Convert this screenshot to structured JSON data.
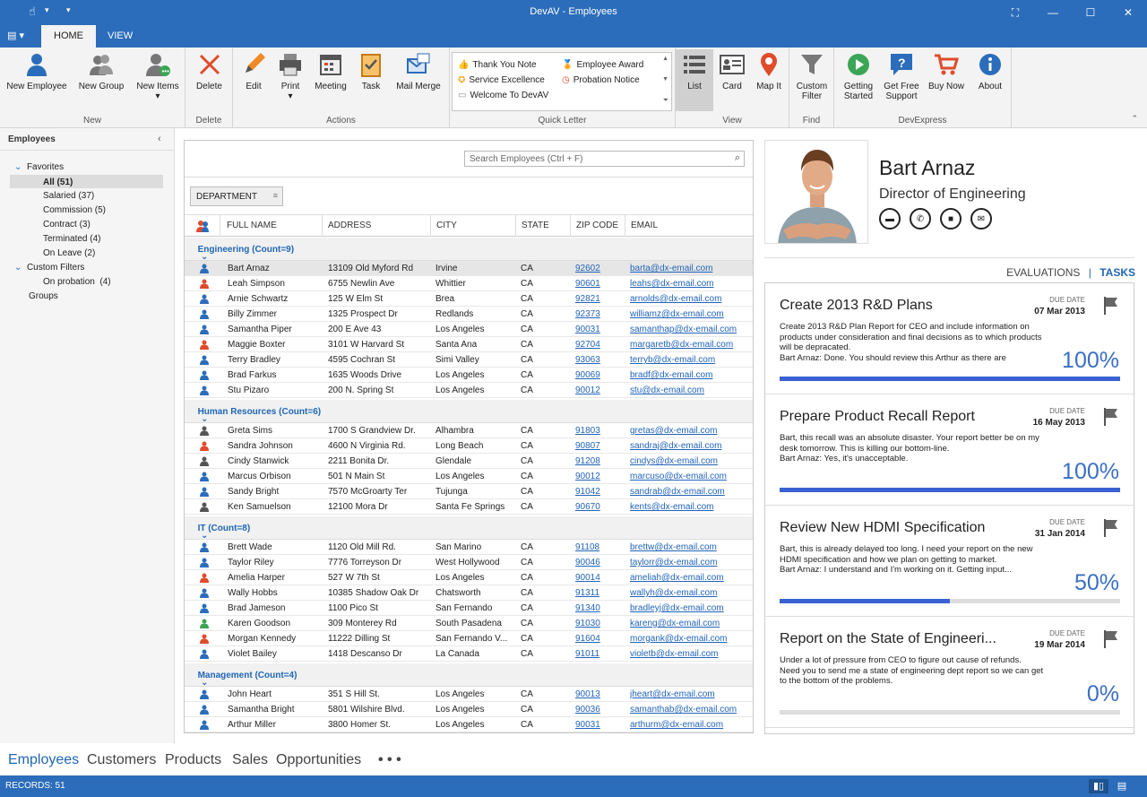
{
  "window": {
    "title": "DevAV - Employees"
  },
  "tabs": [
    {
      "label": "HOME"
    },
    {
      "label": "VIEW"
    }
  ],
  "ribbon": {
    "new_employee": "New Employee",
    "new_group": "New Group",
    "new_items": "New Items",
    "new_group_label": "New",
    "delete": "Delete",
    "delete_group_label": "Delete",
    "edit": "Edit",
    "print": "Print",
    "meeting": "Meeting",
    "task": "Task",
    "mail_merge": "Mail Merge",
    "actions_group_label": "Actions",
    "quick_letter": [
      "Thank You Note",
      "Employee Award",
      "Service Excellence",
      "Probation Notice",
      "Welcome To DevAV"
    ],
    "quick_letter_label": "Quick Letter",
    "list": "List",
    "card": "Card",
    "map_it": "Map It",
    "view_group_label": "View",
    "custom_filter": "Custom Filter",
    "find_group_label": "Find",
    "getting_started": "Getting Started",
    "get_free_support": "Get Free Support",
    "buy_now": "Buy Now",
    "about": "About",
    "devexpress_group_label": "DevExpress",
    "colors": {
      "blue": "#2b6dbb",
      "red": "#e04b2a",
      "green": "#3aa655",
      "orange": "#f08a24"
    }
  },
  "left_panel": {
    "title": "Employees",
    "favorites": "Favorites",
    "items": [
      "All (51)",
      "Salaried (37)",
      "Commission (5)",
      "Contract (3)",
      "Terminated (4)",
      "On Leave (2)"
    ],
    "custom_filters": "Custom Filters",
    "custom_items": [
      "On probation  (4)"
    ],
    "groups": "Groups"
  },
  "grid": {
    "search_placeholder": "Search Employees (Ctrl + F)",
    "group_by": "DEPARTMENT",
    "columns": [
      "FULL NAME",
      "ADDRESS",
      "CITY",
      "STATE",
      "ZIP CODE",
      "EMAIL"
    ],
    "groups": [
      {
        "label": "Engineering (Count=9)",
        "rows": [
          [
            "Bart Arnaz",
            "13109 Old Myford Rd",
            "Irvine",
            "CA",
            "92602",
            "barta@dx-email.com",
            "b"
          ],
          [
            "Leah Simpson",
            "6755 Newlin Ave",
            "Whittier",
            "CA",
            "90601",
            "leahs@dx-email.com",
            "r"
          ],
          [
            "Arnie Schwartz",
            "125 W Elm St",
            "Brea",
            "CA",
            "92821",
            "arnolds@dx-email.com",
            "b"
          ],
          [
            "Billy Zimmer",
            "1325 Prospect Dr",
            "Redlands",
            "CA",
            "92373",
            "williamz@dx-email.com",
            "b"
          ],
          [
            "Samantha Piper",
            "200 E Ave 43",
            "Los Angeles",
            "CA",
            "90031",
            "samanthap@dx-email.com",
            "b"
          ],
          [
            "Maggie Boxter",
            "3101 W Harvard St",
            "Santa Ana",
            "CA",
            "92704",
            "margaretb@dx-email.com",
            "r"
          ],
          [
            "Terry Bradley",
            "4595 Cochran St",
            "Simi Valley",
            "CA",
            "93063",
            "terryb@dx-email.com",
            "b"
          ],
          [
            "Brad Farkus",
            "1635 Woods Drive",
            "Los Angeles",
            "CA",
            "90069",
            "bradf@dx-email.com",
            "b"
          ],
          [
            "Stu Pizaro",
            "200 N. Spring St",
            "Los Angeles",
            "CA",
            "90012",
            "stu@dx-email.com",
            "b"
          ]
        ]
      },
      {
        "label": "Human Resources (Count=6)",
        "rows": [
          [
            "Greta Sims",
            "1700 S Grandview Dr.",
            "Alhambra",
            "CA",
            "91803",
            "gretas@dx-email.com",
            "k"
          ],
          [
            "Sandra Johnson",
            "4600 N Virginia Rd.",
            "Long Beach",
            "CA",
            "90807",
            "sandraj@dx-email.com",
            "r"
          ],
          [
            "Cindy Stanwick",
            "2211 Bonita Dr.",
            "Glendale",
            "CA",
            "91208",
            "cindys@dx-email.com",
            "k"
          ],
          [
            "Marcus Orbison",
            "501 N Main St",
            "Los Angeles",
            "CA",
            "90012",
            "marcuso@dx-email.com",
            "b"
          ],
          [
            "Sandy Bright",
            "7570 McGroarty Ter",
            "Tujunga",
            "CA",
            "91042",
            "sandrab@dx-email.com",
            "b"
          ],
          [
            "Ken Samuelson",
            "12100 Mora Dr",
            "Santa Fe Springs",
            "CA",
            "90670",
            "kents@dx-email.com",
            "k"
          ]
        ]
      },
      {
        "label": "IT (Count=8)",
        "rows": [
          [
            "Brett Wade",
            "1120 Old Mill Rd.",
            "San Marino",
            "CA",
            "91108",
            "brettw@dx-email.com",
            "b"
          ],
          [
            "Taylor Riley",
            "7776 Torreyson Dr",
            "West Hollywood",
            "CA",
            "90046",
            "taylorr@dx-email.com",
            "b"
          ],
          [
            "Amelia Harper",
            "527 W 7th St",
            "Los Angeles",
            "CA",
            "90014",
            "ameliah@dx-email.com",
            "r"
          ],
          [
            "Wally Hobbs",
            "10385 Shadow Oak Dr",
            "Chatsworth",
            "CA",
            "91311",
            "wallyh@dx-email.com",
            "b"
          ],
          [
            "Brad Jameson",
            "1100 Pico St",
            "San Fernando",
            "CA",
            "91340",
            "bradleyj@dx-email.com",
            "b"
          ],
          [
            "Karen Goodson",
            "309 Monterey Rd",
            "South Pasadena",
            "CA",
            "91030",
            "kareng@dx-email.com",
            "g"
          ],
          [
            "Morgan Kennedy",
            "11222 Dilling St",
            "San Fernando V...",
            "CA",
            "91604",
            "morgank@dx-email.com",
            "r"
          ],
          [
            "Violet Bailey",
            "1418 Descanso Dr",
            "La Canada",
            "CA",
            "91011",
            "violetb@dx-email.com",
            "b"
          ]
        ]
      },
      {
        "label": "Management (Count=4)",
        "rows": [
          [
            "John Heart",
            "351 S Hill St.",
            "Los Angeles",
            "CA",
            "90013",
            "jheart@dx-email.com",
            "b"
          ],
          [
            "Samantha Bright",
            "5801 Wilshire Blvd.",
            "Los Angeles",
            "CA",
            "90036",
            "samanthab@dx-email.com",
            "b"
          ],
          [
            "Arthur Miller",
            "3800 Homer St.",
            "Los Angeles",
            "CA",
            "90031",
            "arthurm@dx-email.com",
            "b"
          ]
        ]
      }
    ]
  },
  "detail": {
    "name": "Bart Arnaz",
    "title": "Director of Engineering",
    "tabs": {
      "evaluations": "EVALUATIONS",
      "sep": "|",
      "tasks": "TASKS"
    },
    "due_label": "DUE DATE",
    "tasks": [
      {
        "title": "Create 2013 R&D Plans",
        "due": "07 Mar 2013",
        "desc": "Create 2013 R&D Plan Report for CEO and include information on products under consideration and final decisions as to which products will be depracated.\nBart Arnaz: Done. You should review this Arthur as there are",
        "pct": "100%",
        "progress": 100
      },
      {
        "title": "Prepare Product Recall Report",
        "due": "16 May 2013",
        "desc": "Bart, this recall was an absolute disaster. Your report better be on my desk tomorrow. This is killing our bottom-line.\nBart Arnaz: Yes, it's unacceptable.",
        "pct": "100%",
        "progress": 100
      },
      {
        "title": "Review New HDMI Specification",
        "due": "31 Jan 2014",
        "desc": "Bart, this is already delayed too long. I need your report on the new HDMI specification and how we plan on getting to market.\nBart Arnaz: I understand and I'm working on it. Getting input...",
        "pct": "50%",
        "progress": 50
      },
      {
        "title": "Report on the State of Engineeri...",
        "due": "19 Mar 2014",
        "desc": "Under a lot of pressure from CEO to figure out cause of refunds. Need you to send me a state of engineering dept report so we can get to the bottom of the problems.",
        "pct": "0%",
        "progress": 0
      }
    ]
  },
  "nav": [
    "Employees",
    "Customers",
    "Products",
    "Sales",
    "Opportunities",
    "• • •"
  ],
  "status": {
    "records": "RECORDS: 51"
  }
}
